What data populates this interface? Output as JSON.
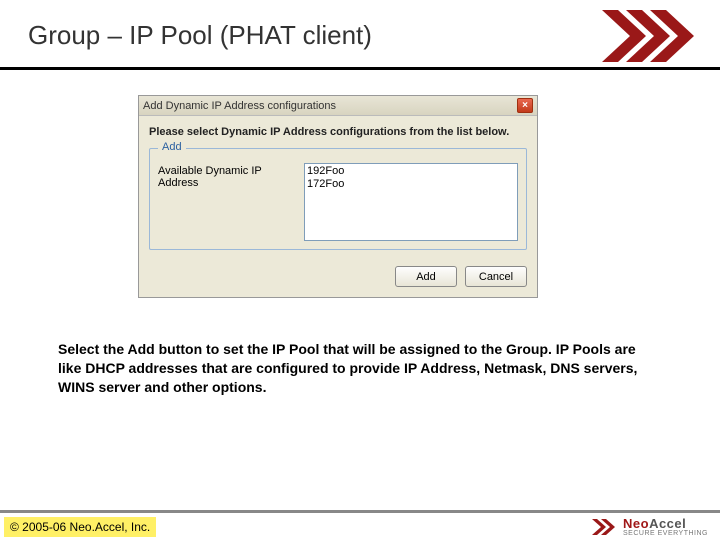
{
  "title": "Group – IP Pool (PHAT client)",
  "dialog": {
    "title": "Add Dynamic IP Address configurations",
    "instruction": "Please select Dynamic IP Address configurations from the list below.",
    "legend": "Add",
    "field_label": "Available Dynamic IP Address",
    "items": [
      "192Foo",
      "172Foo"
    ],
    "add_label": "Add",
    "cancel_label": "Cancel"
  },
  "body": "Select the Add button to set the IP Pool that will be assigned to the Group. IP Pools are like DHCP addresses that are configured to provide IP Address, Netmask, DNS servers, WINS server and other options.",
  "footer": {
    "copyright": "© 2005-06 Neo.Accel, Inc.",
    "logo_neo": "Neo",
    "logo_accel": "Accel",
    "logo_tag": "SECURE EVERYTHING"
  }
}
